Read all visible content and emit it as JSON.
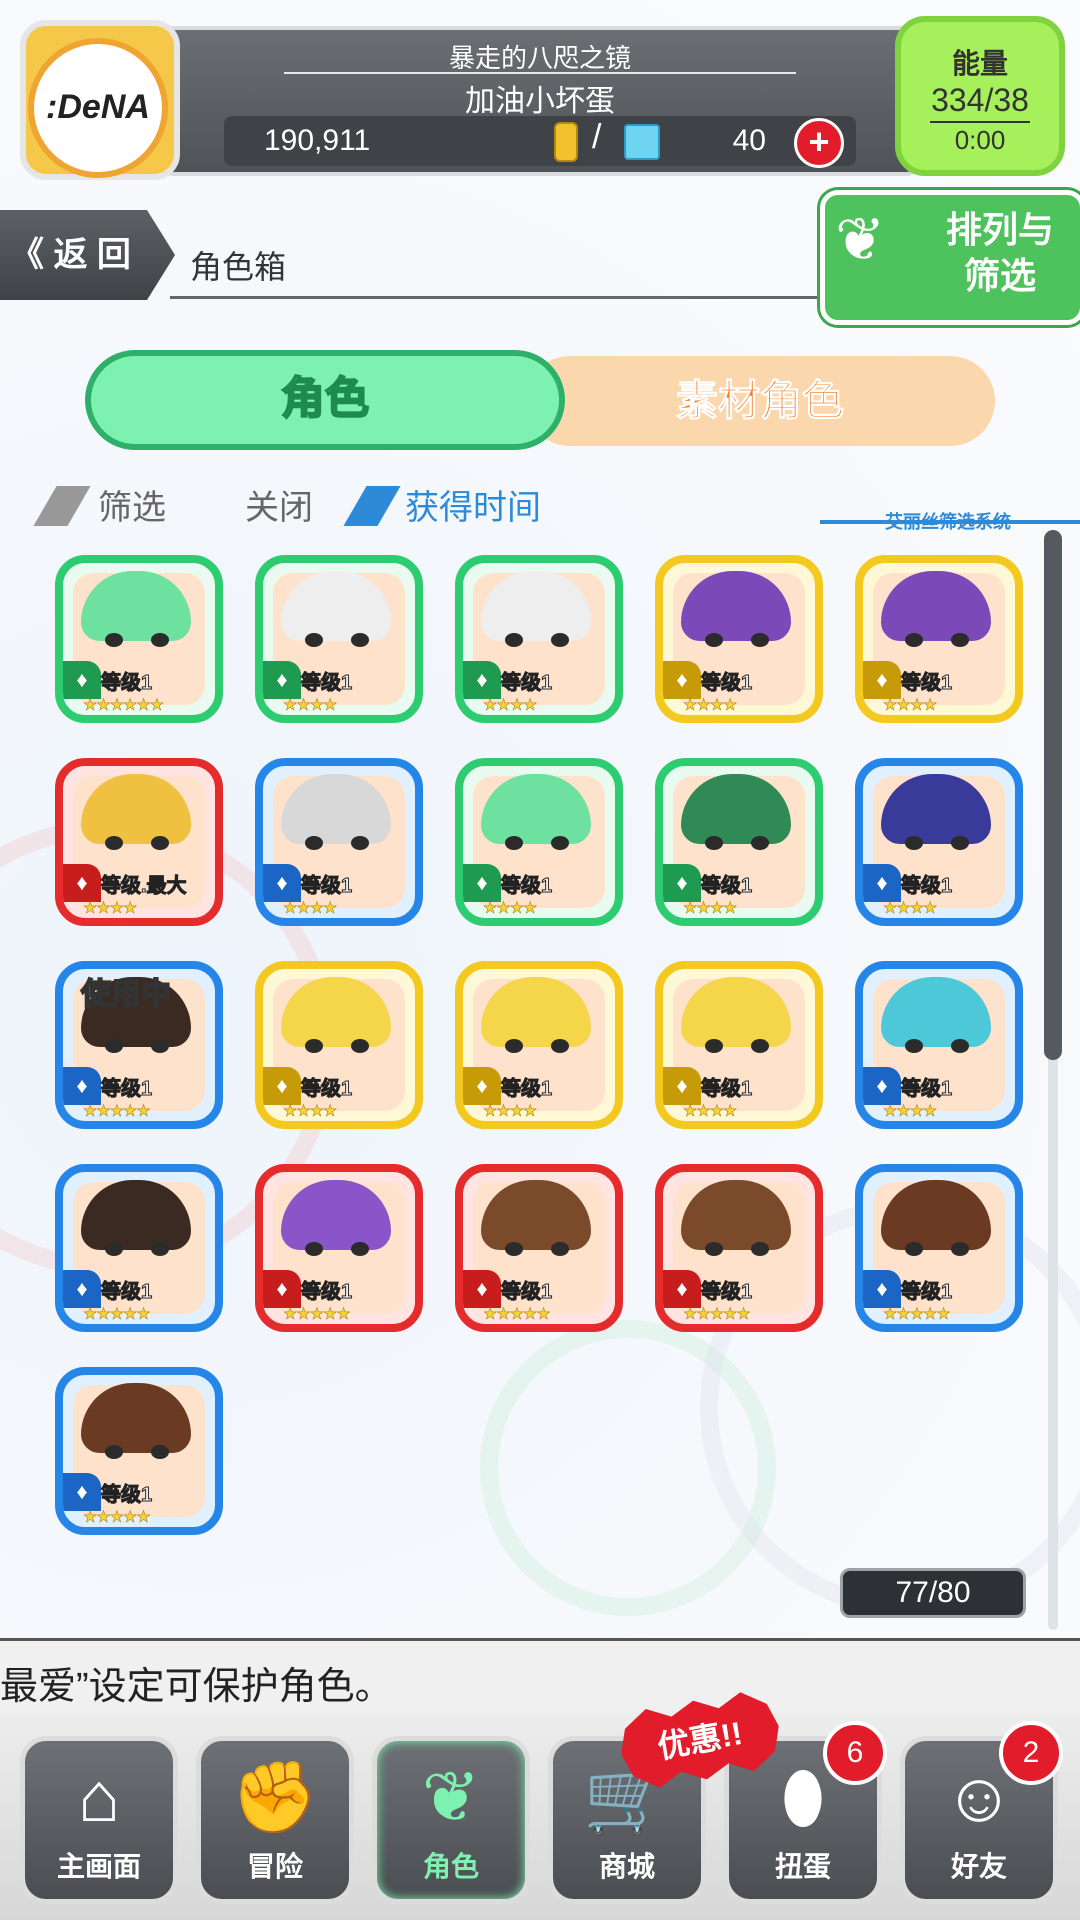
{
  "header": {
    "title": "暴走的八咫之镜",
    "player_name": "加油小坏蛋",
    "gold": "190,911",
    "gems": "40",
    "plus_label": "+",
    "logo_text": ":DeNA",
    "energy_label": "能量",
    "energy_value": "334/38",
    "energy_timer": "0:00"
  },
  "navbar": {
    "back_label": "《 返 回",
    "page_title": "角色箱",
    "sort_filter_label": "排列与筛选"
  },
  "tabs": [
    {
      "label": "角色",
      "active": true
    },
    {
      "label": "素材角色",
      "active": false
    }
  ],
  "filter": {
    "filter_label": "筛选",
    "filter_state": "关闭",
    "sort_label": "获得时间",
    "system_label": "艾丽丝筛选系统"
  },
  "characters": [
    {
      "attr": "green",
      "level": "等级1",
      "stars": "★★★★★★",
      "in_use": ""
    },
    {
      "attr": "green",
      "level": "等级1",
      "stars": "★★★★",
      "in_use": ""
    },
    {
      "attr": "green",
      "level": "等级1",
      "stars": "★★★★",
      "in_use": ""
    },
    {
      "attr": "yellow",
      "level": "等级1",
      "stars": "★★★★",
      "in_use": ""
    },
    {
      "attr": "yellow",
      "level": "等级1",
      "stars": "★★★★",
      "in_use": ""
    },
    {
      "attr": "red",
      "level": "等级.最大",
      "stars": "★★★★",
      "in_use": ""
    },
    {
      "attr": "blue",
      "level": "等级1",
      "stars": "★★★★",
      "in_use": ""
    },
    {
      "attr": "green",
      "level": "等级1",
      "stars": "★★★★",
      "in_use": ""
    },
    {
      "attr": "green",
      "level": "等级1",
      "stars": "★★★★",
      "in_use": ""
    },
    {
      "attr": "blue",
      "level": "等级1",
      "stars": "★★★★",
      "in_use": ""
    },
    {
      "attr": "blue",
      "level": "等级1",
      "stars": "★★★★★",
      "in_use": "使用中"
    },
    {
      "attr": "yellow",
      "level": "等级1",
      "stars": "★★★★",
      "in_use": ""
    },
    {
      "attr": "yellow",
      "level": "等级1",
      "stars": "★★★★",
      "in_use": ""
    },
    {
      "attr": "yellow",
      "level": "等级1",
      "stars": "★★★★",
      "in_use": ""
    },
    {
      "attr": "blue",
      "level": "等级1",
      "stars": "★★★★",
      "in_use": ""
    },
    {
      "attr": "blue",
      "level": "等级1",
      "stars": "★★★★★",
      "in_use": ""
    },
    {
      "attr": "red",
      "level": "等级1",
      "stars": "★★★★★",
      "in_use": ""
    },
    {
      "attr": "red",
      "level": "等级1",
      "stars": "★★★★★",
      "in_use": ""
    },
    {
      "attr": "red",
      "level": "等级1",
      "stars": "★★★★★",
      "in_use": ""
    },
    {
      "attr": "blue",
      "level": "等级1",
      "stars": "★★★★★",
      "in_use": ""
    },
    {
      "attr": "blue",
      "level": "等级1",
      "stars": "★★★★★",
      "in_use": ""
    }
  ],
  "box_count": "77/80",
  "message": "最爱”设定可保护角色。",
  "promo_label": "优惠!!",
  "bottom_nav": [
    {
      "label": "主画面",
      "icon": "home-icon",
      "glyph": "⌂",
      "badge": ""
    },
    {
      "label": "冒险",
      "icon": "handshake-icon",
      "glyph": "✊",
      "badge": ""
    },
    {
      "label": "角色",
      "icon": "rabbit-icon",
      "glyph": "❦",
      "badge": ""
    },
    {
      "label": "商城",
      "icon": "cart-icon",
      "glyph": "🛒",
      "badge": ""
    },
    {
      "label": "扭蛋",
      "icon": "egg-icon",
      "glyph": "⬮",
      "badge": "6"
    },
    {
      "label": "好友",
      "icon": "friends-icon",
      "glyph": "☺",
      "badge": "2"
    }
  ],
  "colors": {
    "green": "#2ecc71",
    "yellow": "#f4c91f",
    "red": "#e52b2b",
    "blue": "#2686e8",
    "accent": "#2c8ad8",
    "tab_active": "#7df2b0",
    "tab_inactive": "#fbd7ad"
  }
}
